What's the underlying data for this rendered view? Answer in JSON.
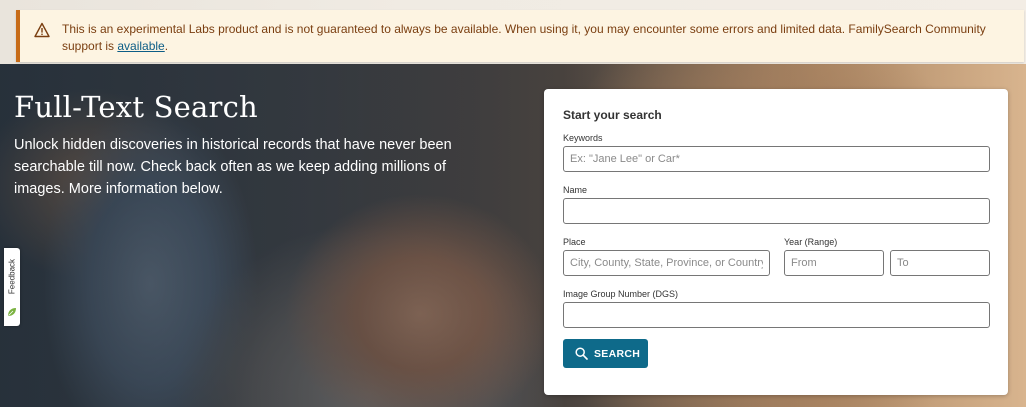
{
  "banner": {
    "icon": "warning-icon",
    "message": "This is an experimental Labs product and is not guaranteed to always be available. When using it, you may encounter some errors and limited data. FamilySearch Community support is ",
    "link_text": "available",
    "suffix": ".",
    "accent_color": "#c76b17"
  },
  "hero": {
    "title": "Full-Text Search",
    "description": "Unlock hidden discoveries in historical records that have never been searchable till now. Check back often as we keep adding millions of images. More information below."
  },
  "feedback": {
    "label": "Feedback",
    "icon": "leaf-icon"
  },
  "search_card": {
    "title": "Start your search",
    "keywords": {
      "label": "Keywords",
      "placeholder": "Ex: \"Jane Lee\" or Car*",
      "value": ""
    },
    "name": {
      "label": "Name",
      "placeholder": "",
      "value": ""
    },
    "place": {
      "label": "Place",
      "placeholder": "City, County, State, Province, or Country",
      "value": ""
    },
    "year": {
      "label": "Year (Range)",
      "from_placeholder": "From",
      "to_placeholder": "To"
    },
    "dgs": {
      "label": "Image Group Number (DGS)",
      "placeholder": "",
      "value": ""
    },
    "button": {
      "label": "SEARCH",
      "icon": "search-icon",
      "color": "#0e6a8a"
    }
  }
}
